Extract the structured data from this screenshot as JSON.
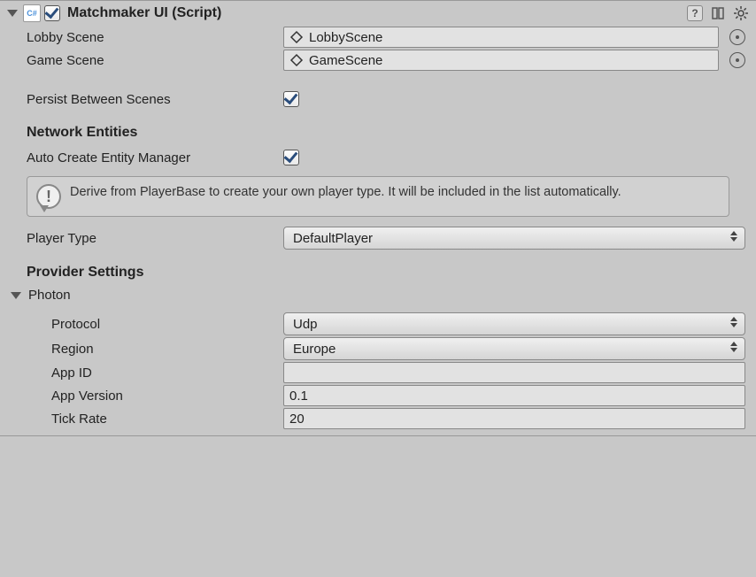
{
  "component": {
    "title": "Matchmaker UI (Script)",
    "enabled": true
  },
  "fields": {
    "lobby_scene_label": "Lobby Scene",
    "lobby_scene_value": "LobbyScene",
    "game_scene_label": "Game Scene",
    "game_scene_value": "GameScene",
    "persist_label": "Persist Between Scenes",
    "persist_value": true
  },
  "network": {
    "section_title": "Network Entities",
    "auto_create_label": "Auto Create Entity Manager",
    "auto_create_value": true,
    "info_text": "Derive from PlayerBase to create your own player type. It will be included in the list automatically.",
    "player_type_label": "Player Type",
    "player_type_value": "DefaultPlayer"
  },
  "provider": {
    "section_title": "Provider Settings",
    "photon_label": "Photon",
    "protocol_label": "Protocol",
    "protocol_value": "Udp",
    "region_label": "Region",
    "region_value": "Europe",
    "appid_label": "App ID",
    "appid_value": "",
    "appversion_label": "App Version",
    "appversion_value": "0.1",
    "tickrate_label": "Tick Rate",
    "tickrate_value": "20"
  }
}
